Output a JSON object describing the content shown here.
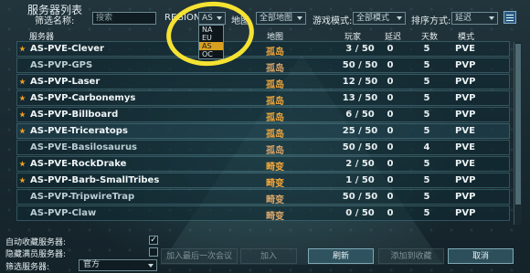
{
  "window_title": "服务器列表",
  "toolbar": {
    "filter_name_label": "筛选名称:",
    "search_placeholder": "搜索",
    "region_label": "REGION:",
    "region_value": "AS",
    "map_label": "地图",
    "map_value": "全部地图",
    "mode_label": "游戏模式:",
    "mode_value": "全部模式",
    "sort_label": "排序方式:",
    "sort_value": "延迟"
  },
  "region_options": [
    "NA",
    "EU",
    "AS",
    "OC"
  ],
  "region_selected_index": 2,
  "columns": {
    "server": "服务器",
    "map": "地图",
    "players": "玩家",
    "latency": "延迟",
    "days": "天数",
    "mode": "模式"
  },
  "servers": [
    {
      "name": "AS-PVE-Clever",
      "map": "孤岛",
      "players": "3 / 50",
      "latency": "0",
      "days": "5",
      "mode": "PVE",
      "favorite": true
    },
    {
      "name": "AS-PVP-GPS",
      "map": "孤岛",
      "players": "50 / 50",
      "latency": "0",
      "days": "5",
      "mode": "PVP",
      "favorite": false
    },
    {
      "name": "AS-PVP-Laser",
      "map": "孤岛",
      "players": "12 / 50",
      "latency": "0",
      "days": "5",
      "mode": "PVP",
      "favorite": true
    },
    {
      "name": "AS-PVP-Carbonemys",
      "map": "孤岛",
      "players": "13 / 50",
      "latency": "0",
      "days": "5",
      "mode": "PVP",
      "favorite": true
    },
    {
      "name": "AS-PVP-Billboard",
      "map": "孤岛",
      "players": "6 / 50",
      "latency": "0",
      "days": "5",
      "mode": "PVP",
      "favorite": true
    },
    {
      "name": "AS-PVE-Triceratops",
      "map": "孤岛",
      "players": "25 / 50",
      "latency": "0",
      "days": "5",
      "mode": "PVE",
      "favorite": true
    },
    {
      "name": "AS-PVE-Basilosaurus",
      "map": "孤岛",
      "players": "50 / 50",
      "latency": "0",
      "days": "4",
      "mode": "PVE",
      "favorite": false
    },
    {
      "name": "AS-PVE-RockDrake",
      "map": "畸变",
      "players": "2 / 50",
      "latency": "0",
      "days": "5",
      "mode": "PVE",
      "favorite": true
    },
    {
      "name": "AS-PVP-Barb-SmallTribes",
      "map": "畸变",
      "players": "1 / 50",
      "latency": "0",
      "days": "5",
      "mode": "PVP",
      "favorite": true
    },
    {
      "name": "AS-PVP-TripwireTrap",
      "map": "畸变",
      "players": "50 / 50",
      "latency": "0",
      "days": "5",
      "mode": "PVP",
      "favorite": false
    },
    {
      "name": "AS-PVP-Claw",
      "map": "畸变",
      "players": "0 / 50",
      "latency": "0",
      "days": "5",
      "mode": "PVP",
      "favorite": false
    }
  ],
  "bottom": {
    "auto_fav_label": "自动收藏服务器:",
    "hide_full_label": "隐藏满员服务器:",
    "filter_server_label": "筛选服务器:",
    "filter_server_value": "官方",
    "join_last_button": "加入最后一次会议",
    "join_button": "加入",
    "refresh_button": "刷新",
    "add_fav_button": "添加到收藏",
    "cancel_button": "取消",
    "auto_fav_checked": true,
    "hide_full_checked": false
  },
  "colors": {
    "accent": "#d9a020",
    "highlight_circle": "#f5e232"
  }
}
